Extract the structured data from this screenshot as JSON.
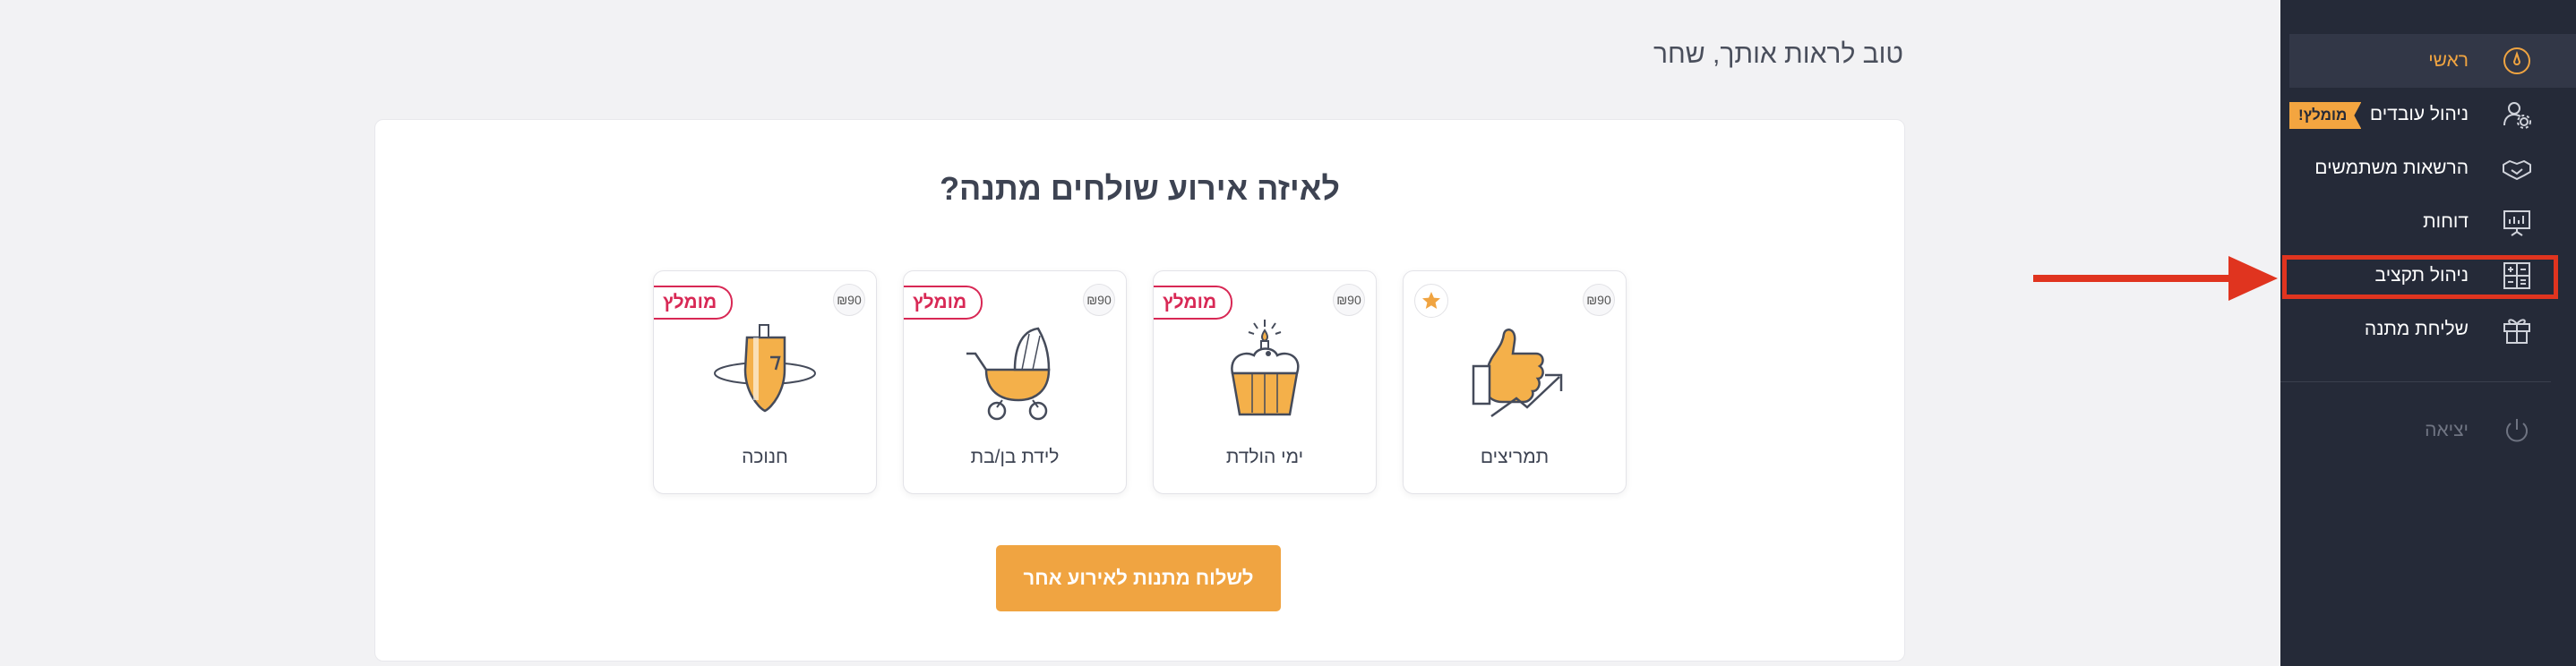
{
  "greeting": "טוב לראות אותך, שחר",
  "question": "לאיזה אירוע שולחים מתנה?",
  "cta_label": "לשלוח מתנות לאירוע אחר",
  "sidebar": {
    "items": [
      {
        "label": "ראשי",
        "icon": "dashboard-icon",
        "active": true
      },
      {
        "label": "ניהול עובדים",
        "icon": "user-settings-icon",
        "badge": "מומלץ!"
      },
      {
        "label": "הרשאות משתמשים",
        "icon": "handshake-icon"
      },
      {
        "label": "דוחות",
        "icon": "presentation-chart-icon"
      },
      {
        "label": "ניהול תקציב",
        "icon": "calculator-icon"
      },
      {
        "label": "שליחת מתנה",
        "icon": "gift-icon"
      }
    ],
    "logout": {
      "label": "יציאה",
      "icon": "power-icon"
    }
  },
  "cards": [
    {
      "label": "תמריצים",
      "corner": "₪90",
      "badge_icon": "star-icon",
      "illustration": "thumbs-up-icon"
    },
    {
      "label": "ימי הולדת",
      "corner": "₪90",
      "badge": "מומלץ",
      "illustration": "cupcake-icon"
    },
    {
      "label": "לידת בן/בת",
      "corner": "₪90",
      "badge": "מומלץ",
      "illustration": "stroller-icon"
    },
    {
      "label": "חנוכה",
      "corner": "₪90",
      "badge": "מומלץ",
      "illustration": "dreidel-icon"
    }
  ],
  "colors": {
    "accent": "#f0a441",
    "sidebar_bg": "#252a38",
    "recommended": "#d82855",
    "annotation": "#e0341f"
  }
}
